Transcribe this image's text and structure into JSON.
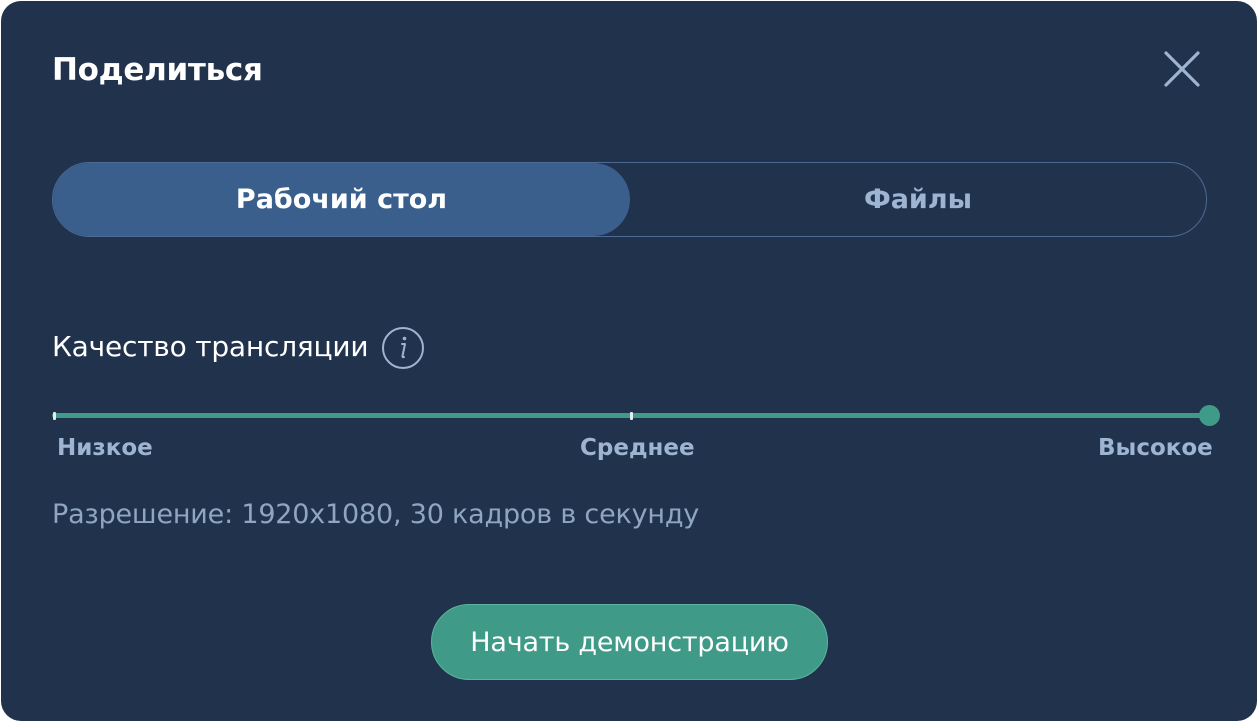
{
  "dialog": {
    "title": "Поделиться",
    "close_icon": "close-icon"
  },
  "tabs": [
    {
      "label": "Рабочий стол",
      "active": true
    },
    {
      "label": "Файлы",
      "active": false
    }
  ],
  "quality": {
    "label": "Качество трансляции",
    "info_icon": "info-icon",
    "levels": [
      "Низкое",
      "Среднее",
      "Высокое"
    ],
    "selected": "Высокое"
  },
  "resolution_text": "Разрешение: 1920x1080, 30 кадров в секунду",
  "start_button_label": "Начать демонстрацию",
  "colors": {
    "background": "#20324c",
    "accent": "#3f9b87",
    "active_tab": "#3a5f8c",
    "muted_text": "#9db4d2"
  }
}
